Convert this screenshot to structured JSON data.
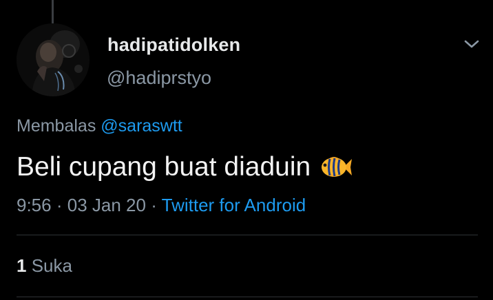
{
  "tweet": {
    "display_name": "hadipatidolken",
    "handle": "@hadiprstyo",
    "reply_prefix": "Membalas",
    "reply_to": "@saraswtt",
    "text": "Beli cupang buat diaduin",
    "emoji_icon": "tropical-fish-icon",
    "time": "9:56",
    "separator": "·",
    "date": "03 Jan 20",
    "source": "Twitter for Android",
    "likes_count": "1",
    "likes_label": "Suka"
  },
  "colors": {
    "background": "#000000",
    "primary_text": "#e7e9ea",
    "secondary_text": "#8b98a5",
    "link": "#1d9bf0",
    "divider": "#2f3336"
  }
}
